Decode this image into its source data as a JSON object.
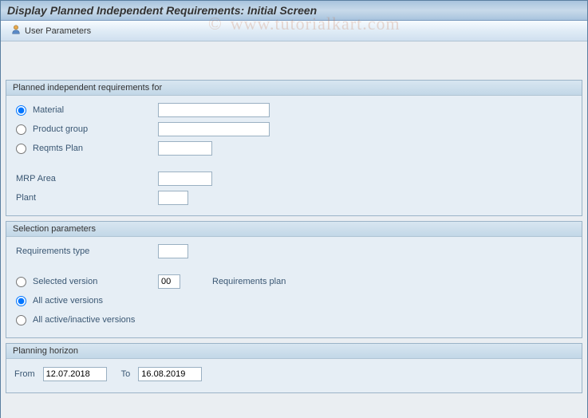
{
  "title": "Display Planned Independent Requirements: Initial Screen",
  "toolbar": {
    "user_parameters": "User Parameters"
  },
  "watermark": {
    "copyright": "©",
    "text": "www.tutorialkart.com"
  },
  "group1": {
    "title": "Planned independent requirements for",
    "opt_material": "Material",
    "opt_product_group": "Product group",
    "opt_reqmts_plan": "Reqmts Plan",
    "mrp_area": "MRP Area",
    "plant": "Plant",
    "material_value": "",
    "product_group_value": "",
    "reqmts_plan_value": "",
    "mrp_area_value": "",
    "plant_value": ""
  },
  "group2": {
    "title": "Selection parameters",
    "requirements_type": "Requirements type",
    "requirements_type_value": "",
    "opt_selected_version": "Selected version",
    "selected_version_value": "00",
    "requirements_plan": "Requirements plan",
    "opt_all_active": "All active versions",
    "opt_all_active_inactive": "All active/inactive versions"
  },
  "group3": {
    "title": "Planning horizon",
    "from": "From",
    "from_value": "12.07.2018",
    "to": "To",
    "to_value": "16.08.2019"
  }
}
